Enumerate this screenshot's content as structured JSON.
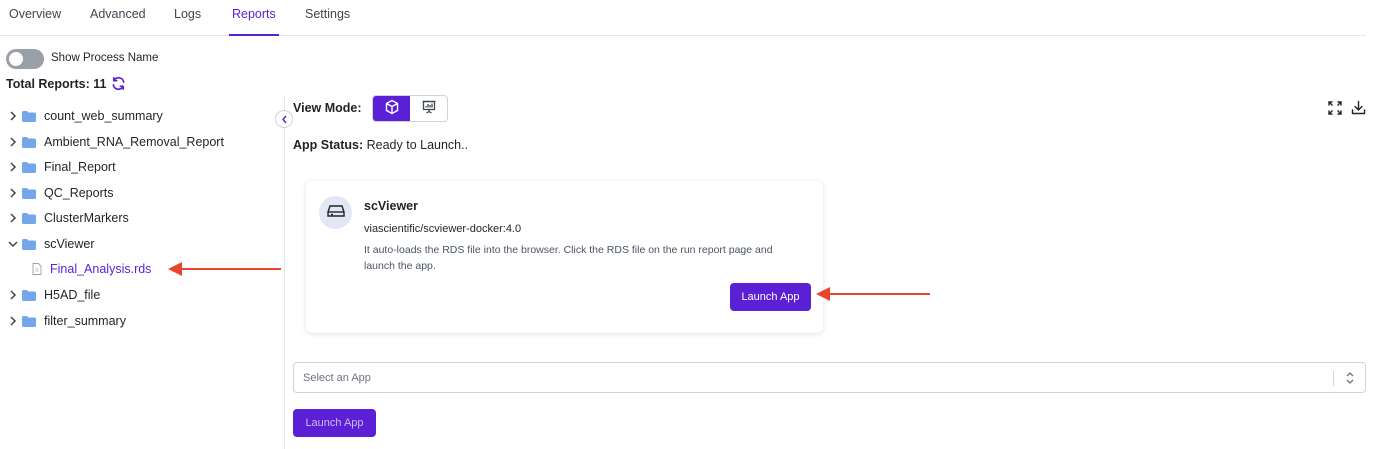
{
  "tabs": [
    {
      "label": "Overview"
    },
    {
      "label": "Advanced"
    },
    {
      "label": "Logs"
    },
    {
      "label": "Reports"
    },
    {
      "label": "Settings"
    }
  ],
  "active_tab": "Reports",
  "left_panel": {
    "toggle_label": "Show Process Name",
    "toggle_on": false,
    "total_reports_label": "Total Reports: 11",
    "tree": [
      {
        "label": "count_web_summary",
        "expanded": false
      },
      {
        "label": "Ambient_RNA_Removal_Report",
        "expanded": false
      },
      {
        "label": "Final_Report",
        "expanded": false
      },
      {
        "label": "QC_Reports",
        "expanded": false
      },
      {
        "label": "ClusterMarkers",
        "expanded": false
      },
      {
        "label": "scViewer",
        "expanded": true,
        "children": [
          {
            "label": "Final_Analysis.rds"
          }
        ]
      },
      {
        "label": "H5AD_file",
        "expanded": false
      },
      {
        "label": "filter_summary",
        "expanded": false
      }
    ]
  },
  "main": {
    "view_mode_label": "View Mode:",
    "app_status_label": "App Status:",
    "app_status_value": "Ready to Launch..",
    "card": {
      "title": "scViewer",
      "image": "viascientific/scviewer-docker:4.0",
      "description": "It auto-loads the RDS file into the browser. Click the RDS file on the run report page and launch the app.",
      "launch_label": "Launch App"
    },
    "select_placeholder": "Select an App",
    "launch_label": "Launch App"
  },
  "colors": {
    "accent": "#5b1fd6",
    "annotation_arrow": "#e8452c",
    "folder": "#74a7ea"
  },
  "icons": [
    "folder-icon",
    "chevron-right-icon",
    "chevron-down-icon",
    "file-icon",
    "refresh-icon",
    "cube-icon",
    "presentation-icon",
    "fullscreen-icon",
    "download-icon",
    "drive-icon",
    "chevron-left-icon",
    "select-arrows-icon"
  ]
}
